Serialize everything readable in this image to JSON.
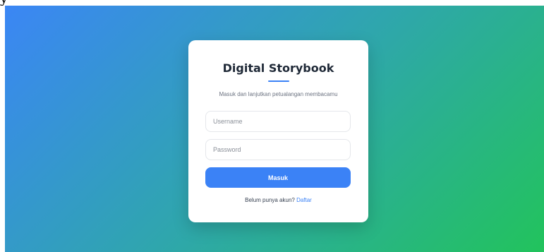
{
  "page": {
    "top_strip_text": "y"
  },
  "login_card": {
    "title": "Digital Storybook",
    "subtitle": "Masuk dan lanjutkan petualangan membacamu",
    "username_placeholder": "Username",
    "password_placeholder": "Password",
    "submit_label": "Masuk",
    "register_prompt": "Belum punya akun?",
    "register_link": "Daftar"
  },
  "colors": {
    "gradient_start": "#3b86f5",
    "gradient_mid": "#2fa6ad",
    "gradient_end": "#22c35c",
    "accent": "#3b82f6",
    "card_background": "#ffffff"
  }
}
